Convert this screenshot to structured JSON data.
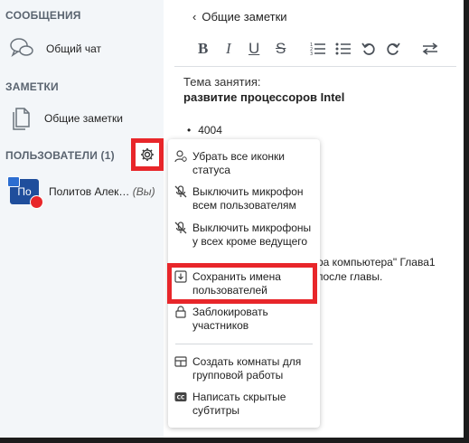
{
  "sidebar": {
    "messages_title": "СООБЩЕНИЯ",
    "public_chat": "Общий чат",
    "notes_title": "ЗАМЕТКИ",
    "shared_notes": "Общие заметки",
    "users_title": "ПОЛЬЗОВАТЕЛИ (1)",
    "user": {
      "initials": "По",
      "name": "Политов Алек…",
      "you": "(Вы)"
    }
  },
  "notes": {
    "back_label": "Общие заметки",
    "toolbar": {
      "bold": "B",
      "italic": "I",
      "underline": "U",
      "strike": "S"
    },
    "topic_label": "Тема занятия:",
    "topic_value": "развитие процессоров Intel",
    "bullet": "4004",
    "partial_line_1": "ра компьютера\" Глава1",
    "partial_line_2": "после главы."
  },
  "menu": {
    "items": [
      "Убрать все иконки статуса",
      "Выключить микрофон всем пользователям",
      "Выключить микрофоны у всех кроме ведущего",
      "Сохранить имена пользователей",
      "Заблокировать участников",
      "Создать комнаты для групповой работы",
      "Написать скрытые субтитры"
    ],
    "icons": [
      "status-clear-icon",
      "mic-off-icon",
      "mic-off-icon",
      "download-icon",
      "lock-icon",
      "breakout-rooms-icon",
      "cc-icon"
    ]
  },
  "colors": {
    "highlight": "#e8262a",
    "sidebar_bg": "#f3f6f9",
    "avatar": "#1f4e9c"
  }
}
